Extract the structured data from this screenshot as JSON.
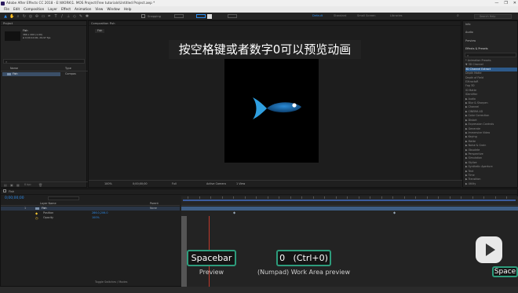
{
  "window": {
    "title": "Adobe After Effects CC 2018 - E:\\WORK\\1. MOS Project\\Free tutorials\\Untitled Project.aep *",
    "controls": [
      "—",
      "❐",
      "✕"
    ]
  },
  "menu": [
    "File",
    "Edit",
    "Composition",
    "Layer",
    "Effect",
    "Animation",
    "View",
    "Window",
    "Help"
  ],
  "toolbar": {
    "snapping_label": "Snapping",
    "workspaces": [
      {
        "label": "Default",
        "active": true
      },
      {
        "label": "Standard",
        "active": false
      },
      {
        "label": "Small Screen",
        "active": false
      },
      {
        "label": "Libraries",
        "active": false
      }
    ],
    "search_placeholder": "Search Help"
  },
  "project_panel": {
    "title": "Project",
    "item_name": "Fish",
    "item_details": [
      "386 x 400 (1.00)",
      "Δ 0;00;10;00, 29.97 fps"
    ],
    "search_placeholder": "",
    "columns": [
      "Name",
      "Type"
    ],
    "rows": [
      {
        "name": "Fish",
        "type": "Compos"
      }
    ]
  },
  "comp_viewer": {
    "tab": "Composition Fish",
    "sub_tab": "Fish",
    "caption": "按空格键或者数字0可以预览动画",
    "footer": {
      "zoom": "100%",
      "time": "0;00;00;00",
      "resolution": "Full",
      "camera": "Active Camera",
      "views": "1 View"
    }
  },
  "right_panel": {
    "sections": [
      "Info",
      "Audio",
      "Preview",
      "Effects & Presets"
    ],
    "effects_search": "",
    "effects": [
      {
        "label": "* Animation Presets",
        "selected": false
      },
      {
        "label": "▼ 3D Channel",
        "selected": false
      },
      {
        "label": "3D Channel Extract",
        "selected": true
      },
      {
        "label": "Depth Matte",
        "selected": false
      },
      {
        "label": "Depth of Field",
        "selected": false
      },
      {
        "label": "EXtractoR",
        "selected": false
      },
      {
        "label": "Fog 3D",
        "selected": false
      },
      {
        "label": "ID Matte",
        "selected": false
      },
      {
        "label": "IDentifier",
        "selected": false
      },
      {
        "label": "▶ Audio",
        "selected": false
      },
      {
        "label": "▶ Blur & Sharpen",
        "selected": false
      },
      {
        "label": "▶ Channel",
        "selected": false
      },
      {
        "label": "▶ CINEMA 4D",
        "selected": false
      },
      {
        "label": "▶ Color Correction",
        "selected": false
      },
      {
        "label": "▶ Distort",
        "selected": false
      },
      {
        "label": "▶ Expression Controls",
        "selected": false
      },
      {
        "label": "▶ Generate",
        "selected": false
      },
      {
        "label": "▶ Immersive Video",
        "selected": false
      },
      {
        "label": "▶ Keying",
        "selected": false
      },
      {
        "label": "▶ Matte",
        "selected": false
      },
      {
        "label": "▶ Noise & Grain",
        "selected": false
      },
      {
        "label": "▶ Obsolete",
        "selected": false
      },
      {
        "label": "▶ Perspective",
        "selected": false
      },
      {
        "label": "▶ Simulation",
        "selected": false
      },
      {
        "label": "▶ Stylize",
        "selected": false
      },
      {
        "label": "▶ Synthetic Aperture",
        "selected": false
      },
      {
        "label": "▶ Text",
        "selected": false
      },
      {
        "label": "▶ Time",
        "selected": false
      },
      {
        "label": "▶ Transition",
        "selected": false
      },
      {
        "label": "▶ Utility",
        "selected": false
      }
    ]
  },
  "timeline": {
    "tab": "Fish",
    "timecode": "0;00;00;00",
    "columns": [
      "Layer Name",
      "Parent"
    ],
    "layers": [
      {
        "num": "1",
        "name": "Fish",
        "parent": "None"
      },
      {
        "num": "",
        "name": "Position",
        "parent": "286.0,206.0"
      },
      {
        "num": "",
        "name": "Opacity",
        "parent": "100%"
      }
    ],
    "footer": "Toggle Switches / Modes"
  },
  "overlays": {
    "spacebar_key": "Spacebar",
    "spacebar_label": "Preview",
    "numpad_key": "0   (Ctrl+0)",
    "numpad_label": "(Numpad) Work Area preview",
    "space_badge": "Space"
  },
  "colors": {
    "accent": "#2d8ceb",
    "key_border": "#2d9c7c",
    "fish_body": "#1a6fb0",
    "fish_tail": "#3aa8e8"
  }
}
